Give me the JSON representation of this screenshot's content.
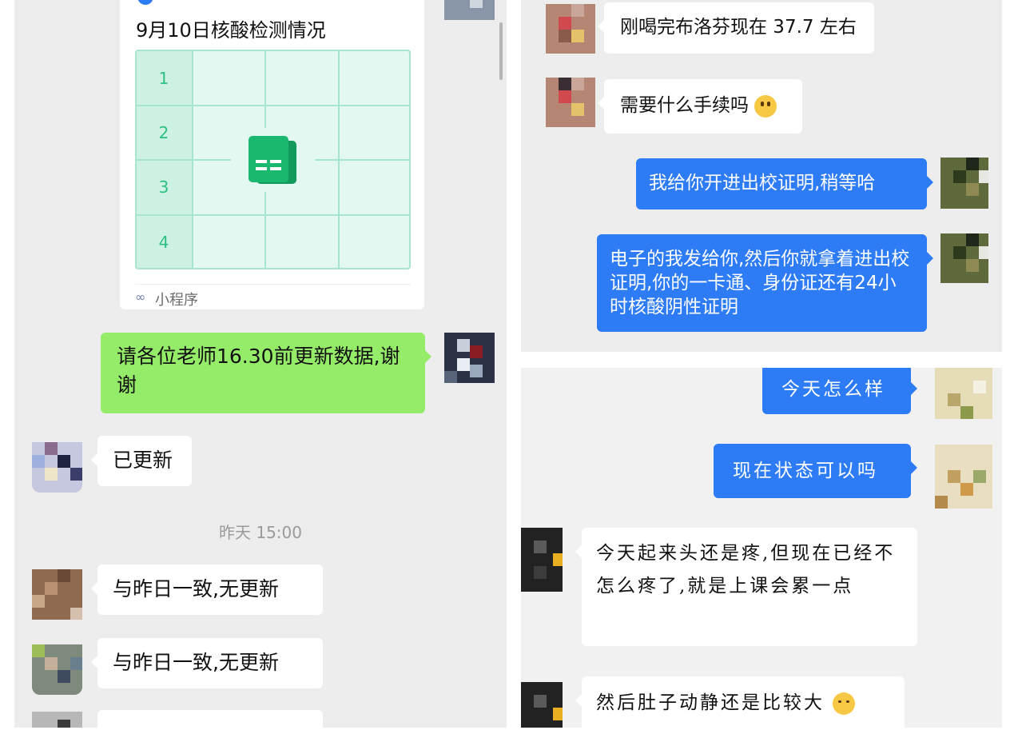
{
  "left": {
    "card": {
      "title": "9月10日核酸检测情况",
      "rows": [
        "1",
        "2",
        "3",
        "4"
      ],
      "footer_label": "小程序",
      "footer_icon": "mini-program-icon",
      "preview_icon": "spreadsheet-icon"
    },
    "messages": [
      {
        "text": "请各位老师16.30前更新数据,谢谢",
        "side": "right",
        "color": "#95ec69"
      },
      {
        "text": "已更新",
        "side": "left"
      },
      {
        "text": "与昨日一致,无更新",
        "side": "left"
      },
      {
        "text": "与昨日一致,无更新",
        "side": "left"
      }
    ],
    "timestamp": "昨天 15:00"
  },
  "right_top": {
    "messages": [
      {
        "text": "刚喝完布洛芬现在 37.7 左右",
        "side": "left"
      },
      {
        "text": "需要什么手续吗",
        "side": "left",
        "emoji": "crying-face-icon"
      },
      {
        "text": "我给你开进出校证明,稍等哈",
        "side": "right",
        "color": "#2d7cf6"
      },
      {
        "text": "电子的我发给你,然后你就拿着进出校证明,你的一卡通、身份证还有24小时核酸阴性证明",
        "side": "right",
        "color": "#2d7cf6"
      }
    ]
  },
  "right_bottom": {
    "messages": [
      {
        "text": "今天怎么样",
        "side": "right",
        "color": "#2d7cf6"
      },
      {
        "text": "现在状态可以吗",
        "side": "right",
        "color": "#2d7cf6"
      },
      {
        "text": "今天起来头还是疼,但现在已经不怎么疼了,就是上课会累一点",
        "side": "left"
      },
      {
        "text": "然后肚子动静还是比较大",
        "side": "left",
        "emoji": "laughing-tears-icon"
      }
    ]
  }
}
